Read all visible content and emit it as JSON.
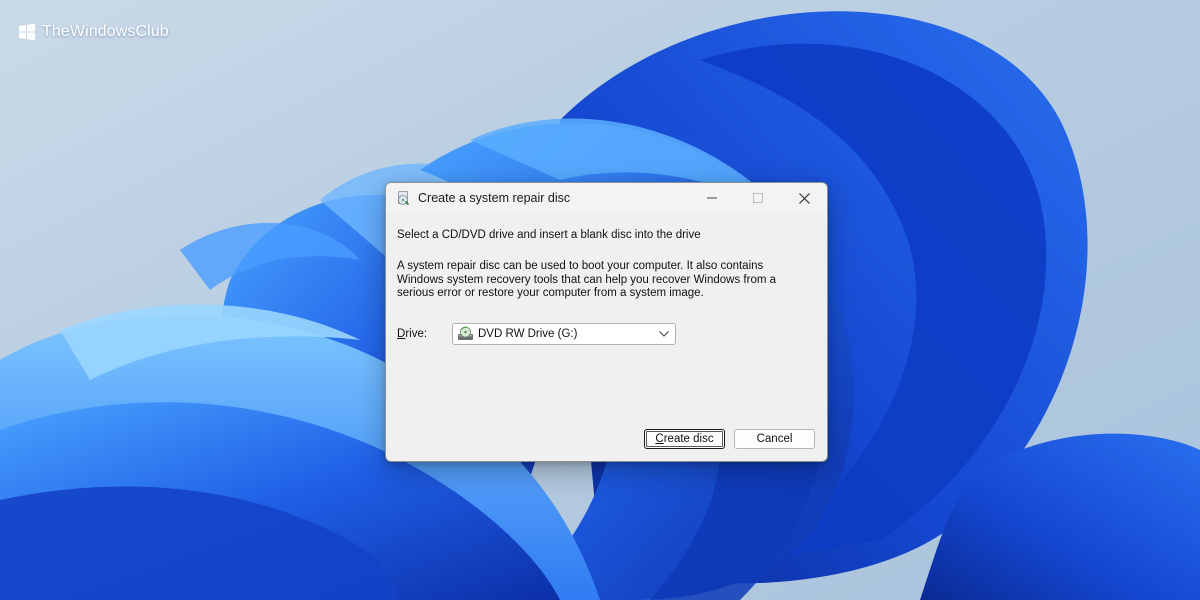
{
  "brand": {
    "name": "TheWindowsClub"
  },
  "dialog": {
    "title": "Create a system repair disc",
    "instruction": "Select a CD/DVD drive and insert a blank disc into the drive",
    "description": "A system repair disc can be used to boot your computer. It also contains Windows system recovery tools that can help you recover Windows from a serious error or restore your computer from a system image.",
    "drive_label_accel": "D",
    "drive_label_rest": "rive:",
    "drive_value": "DVD RW Drive (G:)",
    "create_accel": "C",
    "create_rest": "reate disc",
    "cancel_label": "Cancel"
  },
  "colors": {
    "wallpaper_background": "#b7cde0",
    "bloom_blue": "#1f5fe6",
    "dialog_background": "#f0f0f0"
  },
  "icons": {
    "brand": "windows-logo-icon",
    "title": "repair-disc-icon",
    "drive": "dvd-drive-icon",
    "dropdown": "chevron-down-icon"
  }
}
